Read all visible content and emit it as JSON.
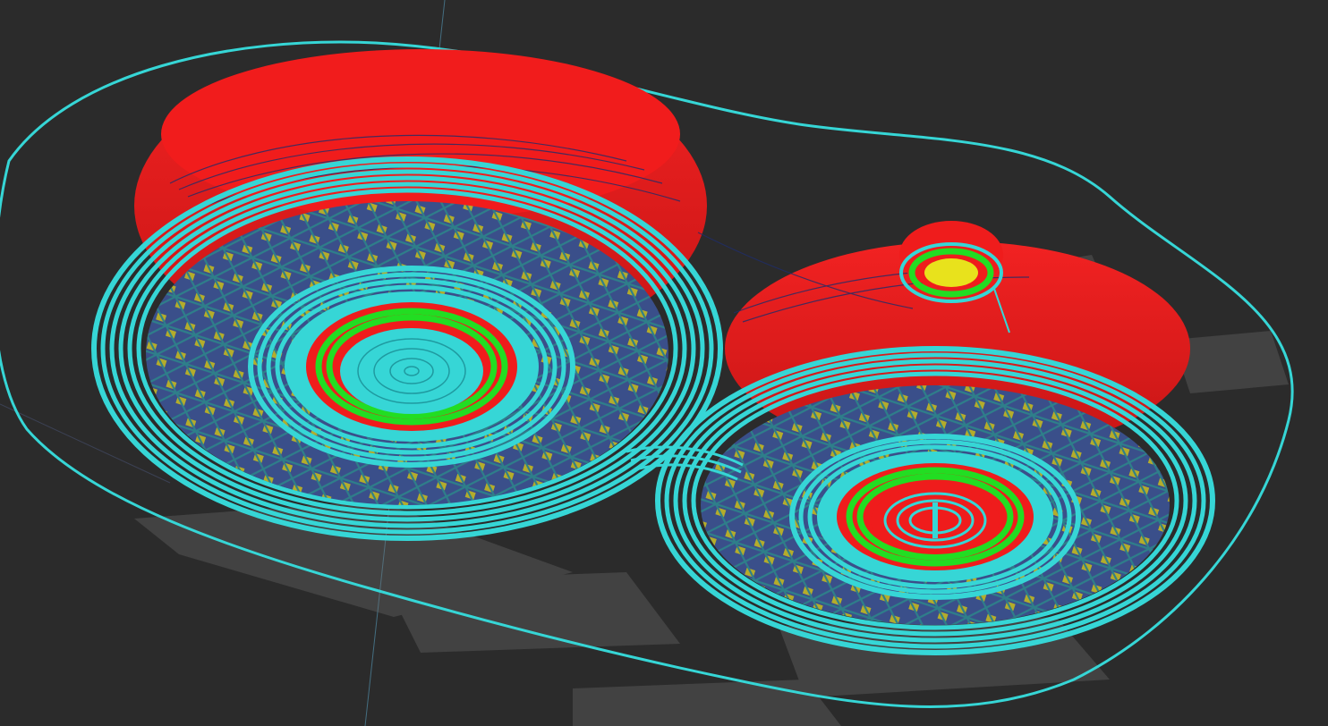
{
  "viewport": {
    "view": "layer-view-3d",
    "background_color": "#2b2b2b"
  },
  "colors": {
    "wall": "#ef1c1c",
    "wall_dark": "#b81414",
    "outer_perimeter": "#36d6d6",
    "skirt": "#3cc8c8",
    "inner_wall": "#22dd22",
    "infill": "#3a4f8a",
    "infill_highlight": "#d8c81c",
    "travel": "#2a3a7a",
    "support_ghost": "#6e6e6e"
  },
  "objects": [
    {
      "name": "large-gear",
      "shape": "disc-with-hub"
    },
    {
      "name": "small-gear",
      "shape": "disc-with-hub"
    },
    {
      "name": "small-peg",
      "shape": "cylinder"
    }
  ]
}
